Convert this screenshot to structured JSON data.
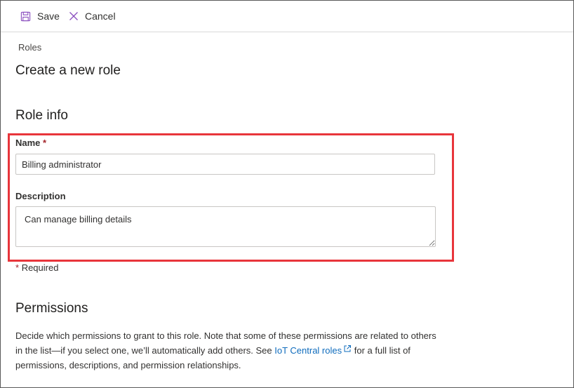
{
  "toolbar": {
    "save_label": "Save",
    "cancel_label": "Cancel"
  },
  "breadcrumb": "Roles",
  "page_title": "Create a new role",
  "role_info": {
    "title": "Role info",
    "name_label": "Name",
    "required_marker": "*",
    "name_value": "Billing administrator",
    "description_label": "Description",
    "description_value": "Can manage billing details",
    "required_note_marker": "*",
    "required_note_text": "Required"
  },
  "permissions": {
    "title": "Permissions",
    "desc_before": "Decide which permissions to grant to this role. Note that some of these permissions are related to others in the list—if you select one, we’ll automatically add others. See ",
    "link_text": "IoT Central roles",
    "desc_after": " for a full list of permissions, descriptions, and permission relationships."
  },
  "colors": {
    "highlight_border": "#e8353b",
    "link": "#0f6cbd",
    "icon_accent": "#8a4fbf",
    "required": "#a4262c"
  },
  "icons": [
    "save-icon",
    "cancel-icon",
    "external-link-icon"
  ]
}
